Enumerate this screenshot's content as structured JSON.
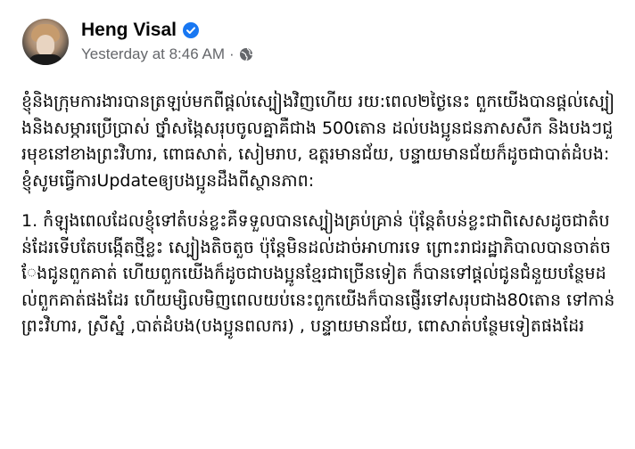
{
  "post": {
    "author_name": "Heng Visal",
    "timestamp": "Yesterday at 8:46 AM",
    "separator": "·",
    "icons": {
      "verified": "verified-badge-icon",
      "audience": "globe-icon",
      "verified_color": "#1877f2"
    },
    "paragraphs": [
      "ខ្ញុំនិងក្រុមការងារបានត្រឡប់មកពីផ្តល់ស្បៀងវិញហើយ រយ:ពេល២ថ្ងៃនេះ ពួកយើងបានផ្តល់ស្បៀងនិងសម្ភារប្រើប្រាស់ ថ្នាំសង្កៃសរុបចូលគ្នាគឺជាង 500តោន ដល់បងប្អូនជនភាសសឹក និងបងៗជួរមុខនៅខាងព្រះវិហារ, ពោធសាត់, សៀមរាប, ឧត្តរមានជ័យ, បន្ទាយមានជ័យក៏ដូចជាបាត់ដំបង: ខ្ញុំសូមធ្វើការUpdateឲ្យបងប្អូនដឹងពីស្ថានភាព:",
      "1. កំឡុងពេលដែលខ្ញុំទៅតំបន់ខ្លះគឺទទួលបានស្បៀងគ្រប់គ្រាន់ ប៉ុន្តែតំបន់ខ្លះជាពិសេសដូចជាតំបន់ដែរទើបតែបង្កើតថ្មីខ្លះ ស្បៀងតិចតួច ប៉ុន្តែមិនដល់ដាច់អាហារទេ ព្រោះរាជរដ្ឋាភិបាលបានចាត់ចែងជូនពួកគាត់ ហើយពួកយើងក៏ដូចជាបងប្អូនខ្មែរជាច្រើនទៀត ក៏បានទៅផ្តល់ជូនជំនួយបន្ថែមដល់ពួកគាត់ផងដែរ ហើយម្សិលមិញពេលយប់នេះពួកយើងក៏បានផ្ញើរទៅសរុបជាង80តោន ទៅកាន់ ព្រះវិហារ, ស្រីស្នំ ,បាត់ដំបង(បងប្អូនពលករ) , បន្ទាយមានជ័យ, ពោសាត់បន្ថែមទៀតផងដែរ"
    ]
  }
}
